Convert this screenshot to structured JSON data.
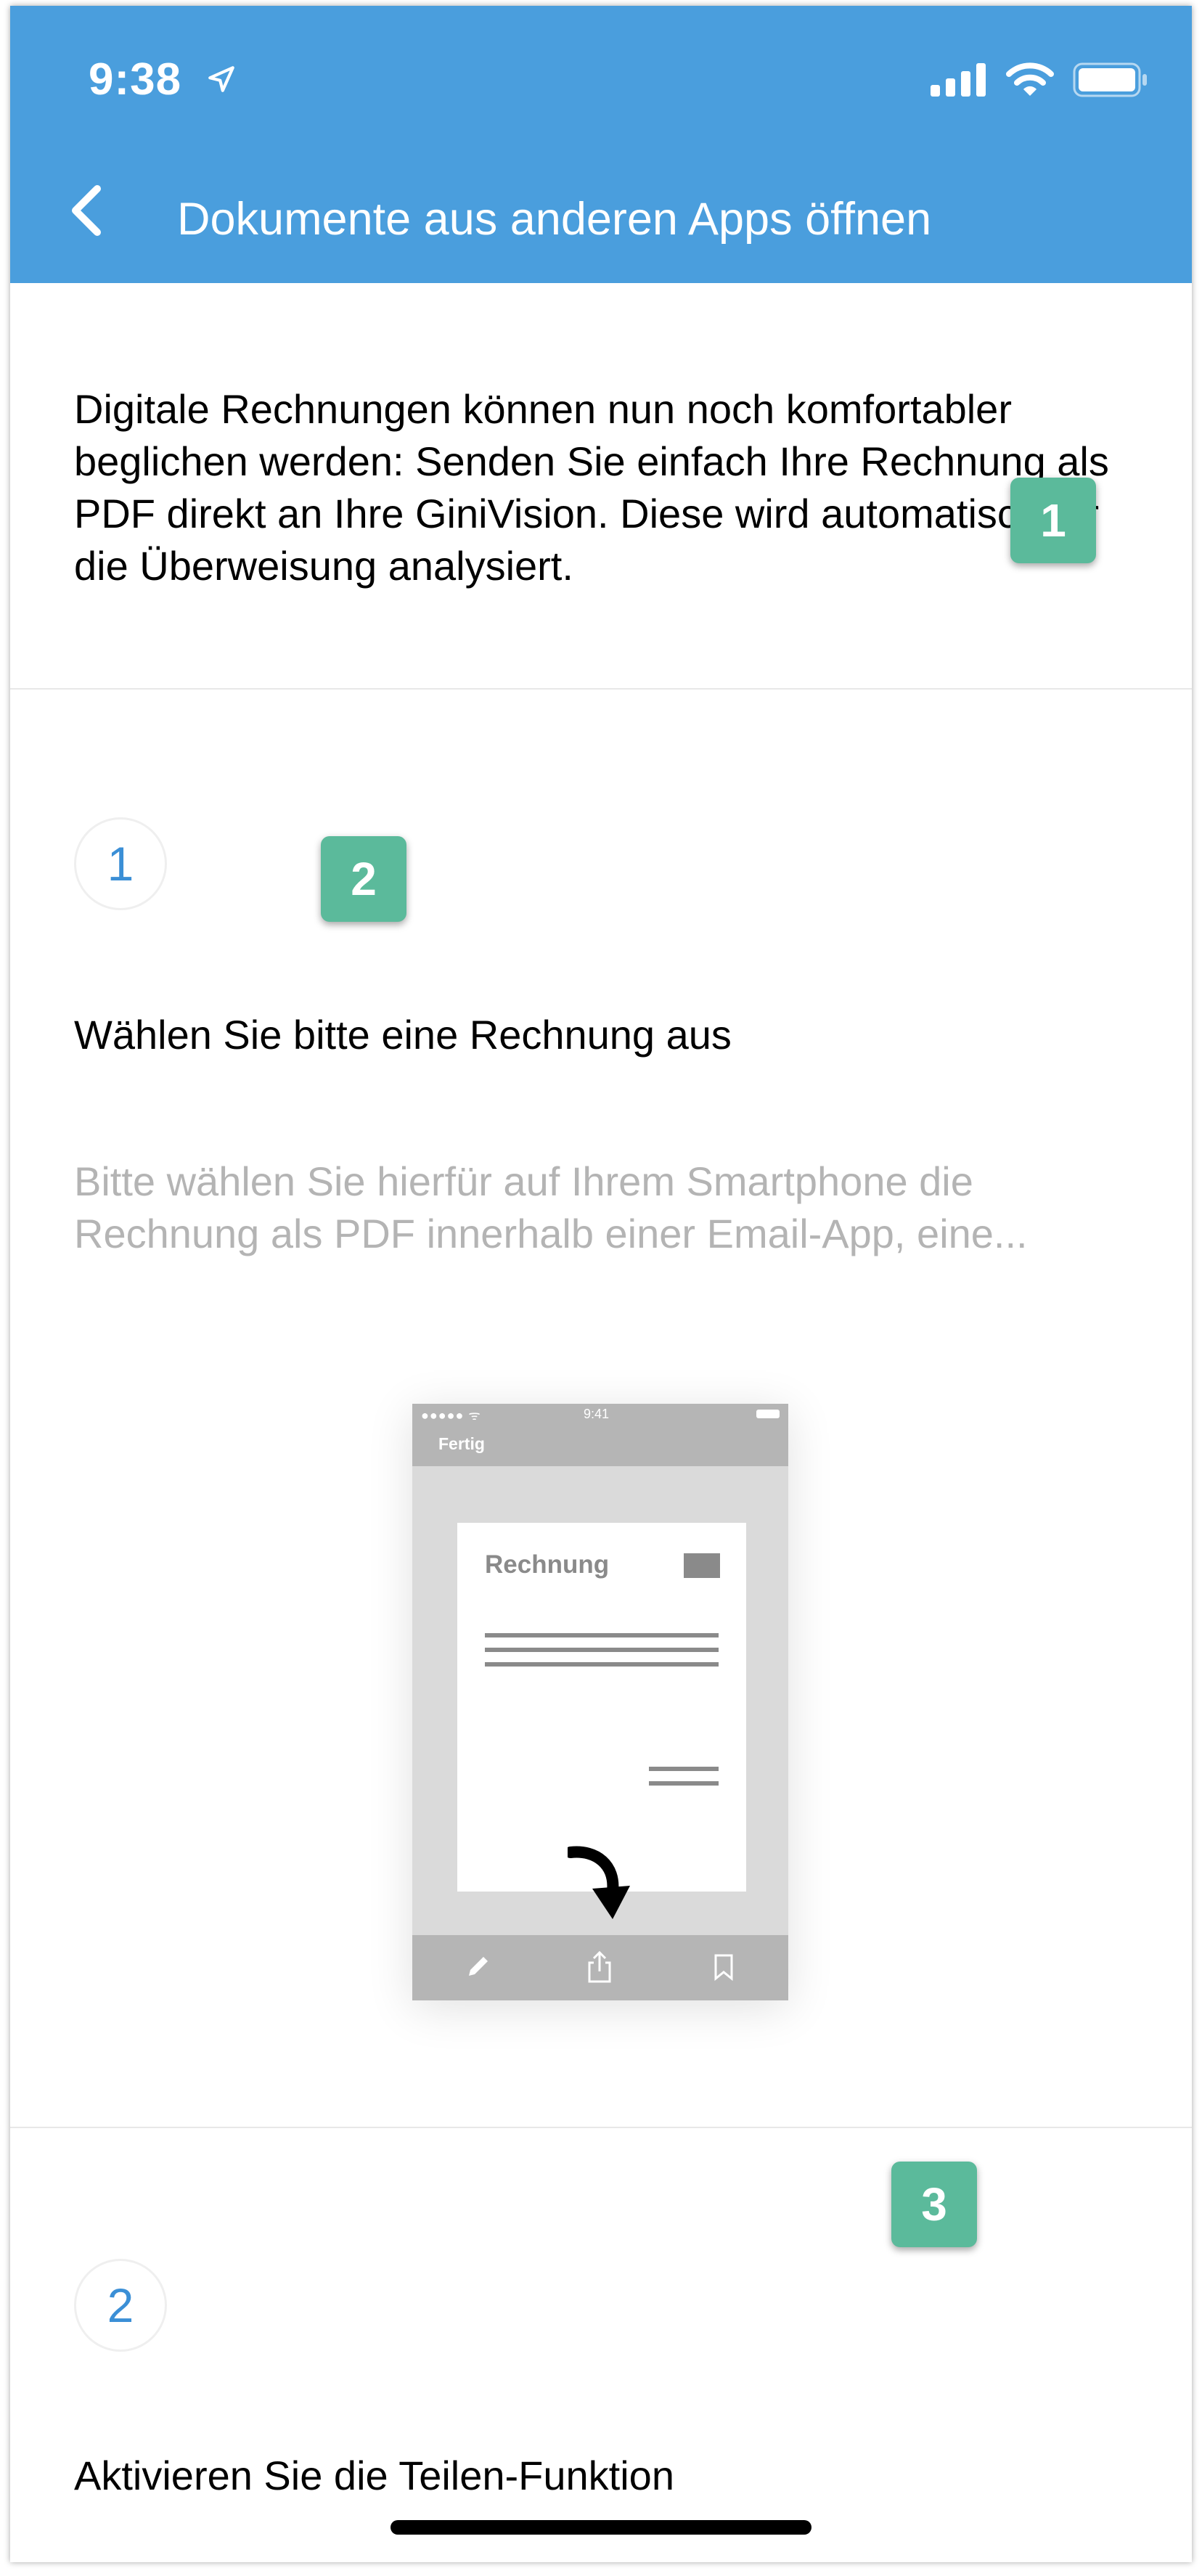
{
  "status_bar": {
    "time": "9:38"
  },
  "nav": {
    "title": "Dokumente aus anderen Apps öffnen"
  },
  "intro": {
    "text": "Digitale Rechnungen können nun noch komfortabler beglichen werden: Senden Sie einfach Ihre Rechnung als PDF direkt an Ihre GiniVision. Diese wird automatisch für die Überweisung analysiert."
  },
  "steps": [
    {
      "number": "1",
      "title": "Wählen Sie bitte eine Rechnung aus",
      "description": "Bitte wählen Sie hierfür auf Ihrem Smartphone die Rechnung als PDF innerhalb einer Email-App, eine..."
    },
    {
      "number": "2",
      "title": "Aktivieren Sie die Teilen-Funktion"
    }
  ],
  "illustration": {
    "status_time": "9:41",
    "status_dots": "●●●●● ᯤ",
    "done_label": "Fertig",
    "document_title": "Rechnung"
  },
  "badges": [
    "1",
    "2",
    "3"
  ],
  "colors": {
    "nav_background": "#4a9edd",
    "step_number": "#3b8fd6",
    "badge": "#5bba9b",
    "description_text": "#b4b4b4"
  },
  "icons": {
    "status": [
      "location-arrow-icon",
      "signal-icon",
      "wifi-icon",
      "battery-icon"
    ],
    "nav": [
      "back-chevron-icon"
    ],
    "illustration_toolbar": [
      "pencil-icon",
      "share-icon",
      "bookmark-icon"
    ]
  }
}
